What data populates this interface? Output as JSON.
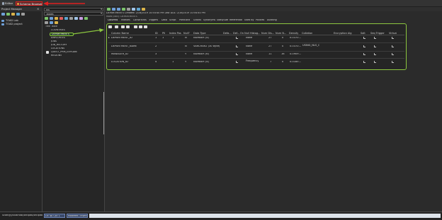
{
  "top_tabs": {
    "editor": "Editor",
    "schema_browser": "Schema Browser"
  },
  "accent": "#e02020",
  "highlight": "#8cc63f",
  "left_panel": {
    "title": "Project Manager",
    "items": [
      "TOAD Lab",
      "TOAD project"
    ]
  },
  "middle_panel": {
    "schema": "HR",
    "filter": "Tables",
    "tabs": "Tree  Table",
    "objects": [
      "COUNTRIES",
      "DEPARTMENTS",
      "EMPLOYEES",
      "JOBS",
      "JOB_HISTORY",
      "LOCATIONS",
      "QUEST_PRM_EXPLAIN",
      "REGIONS"
    ],
    "selected": "DEPARTMENTS"
  },
  "info": {
    "line1": "DEPARTMENTS   Created: 2/16/2019 10:54:40 PM   Last DDL: 2/16/2019 10:54:40 PM",
    "line2": "Rows (calc): DEPARTMENTS"
  },
  "detail_tabs": [
    "Columns",
    "Indexes",
    "Constraints",
    "Triggers",
    "Data",
    "Script",
    "Partitions",
    "Grants",
    "Synonyms",
    "Stats/Size",
    "Referential",
    "Used By",
    "Policies",
    "Auditing"
  ],
  "grid": {
    "headers": [
      "Column Name",
      "ID",
      "PK",
      "Index Pos",
      "Null?",
      "Data Type",
      "Defa...",
      "Def...",
      "On Null Histog...",
      "Num Dis...",
      "Num N...",
      "Density",
      "Collation",
      "Encryption Alg",
      "Salt",
      "Seq Trigger",
      "Virtual"
    ],
    "rows": [
      {
        "name": "DEPARTMENT_ID",
        "id": "1",
        "pk": "1",
        "idx": "1",
        "null": "N",
        "type": "NUMBER (4)",
        "hist": "None",
        "dis": "27",
        "nn": "0",
        "density": "0.0370..."
      },
      {
        "name": "DEPARTMENT_NAME",
        "id": "2",
        "pk": "",
        "idx": "",
        "null": "N",
        "type": "VARCHAR2 (30 Byte)",
        "hist": "None",
        "dis": "27",
        "nn": "0",
        "density": "0.0370...",
        "collation": "USING_NLS_COMP"
      },
      {
        "name": "MANAGER_ID",
        "id": "3",
        "pk": "",
        "idx": "",
        "null": "Y",
        "type": "NUMBER (6)",
        "hist": "None",
        "dis": "11",
        "nn": "16",
        "density": "0.0909..."
      },
      {
        "name": "LOCATION_ID",
        "id": "4",
        "pk": "",
        "idx": "1",
        "null": "Y",
        "type": "NUMBER (4)",
        "hist": "Frequency",
        "dis": "7",
        "nn": "0",
        "density": "0.0185..."
      }
    ]
  },
  "status": {
    "path": "Scott@//localhost/orclpdb/orclpdb",
    "pos": "Ln: 40  Col: 1",
    "mode": "Modified / Insert"
  }
}
